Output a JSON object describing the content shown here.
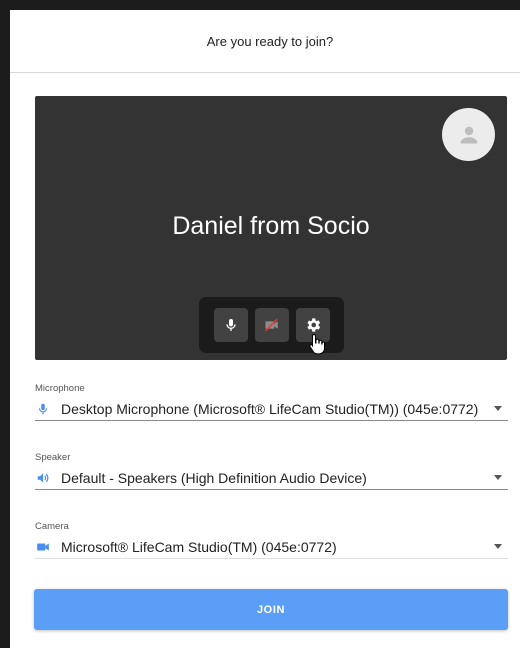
{
  "dialog": {
    "title": "Are you ready to join?"
  },
  "preview": {
    "display_name": "Daniel from Socio",
    "avatar_icon": "person-icon",
    "controls": [
      {
        "name": "microphone",
        "icon": "microphone-icon"
      },
      {
        "name": "camera-off",
        "icon": "camera-off-icon"
      },
      {
        "name": "settings",
        "icon": "gear-icon"
      }
    ]
  },
  "devices": {
    "microphone": {
      "label": "Microphone",
      "value": "Desktop Microphone (Microsoft® LifeCam Studio(TM)) (045e:0772)",
      "icon": "microphone-icon"
    },
    "speaker": {
      "label": "Speaker",
      "value": "Default - Speakers (High Definition Audio Device)",
      "icon": "speaker-icon"
    },
    "camera": {
      "label": "Camera",
      "value": "Microsoft® LifeCam Studio(TM) (045e:0772)",
      "icon": "video-camera-icon"
    }
  },
  "join_button": {
    "label": "JOIN"
  },
  "colors": {
    "accent": "#5b9ef7",
    "preview_bg": "#333333",
    "controls_bg": "#1b1b1b"
  }
}
